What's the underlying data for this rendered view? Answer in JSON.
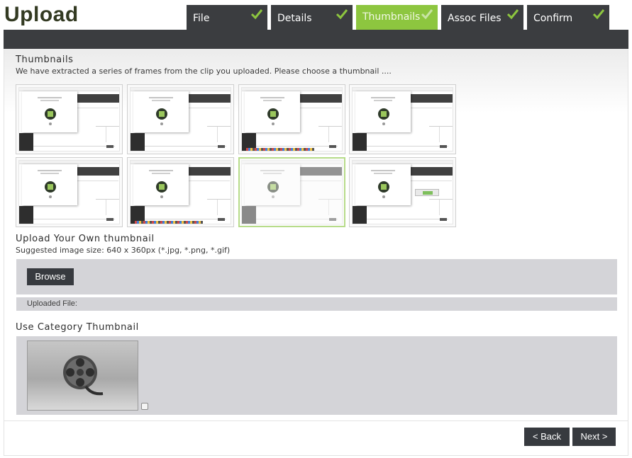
{
  "app": {
    "title": "Upload"
  },
  "steps": [
    {
      "label": "File",
      "completed": true,
      "active": false
    },
    {
      "label": "Details",
      "completed": true,
      "active": false
    },
    {
      "label": "Thumbnails",
      "completed": true,
      "active": true
    },
    {
      "label": "Assoc Files",
      "completed": true,
      "active": false
    },
    {
      "label": "Confirm",
      "completed": true,
      "active": false
    }
  ],
  "thumbnails_section": {
    "title": "Thumbnails",
    "description": "We have extracted a series of frames from the clip you uploaded. Please choose a thumbnail ....",
    "selected_index": 6,
    "frame_count": 8
  },
  "upload_section": {
    "title": "Upload Your Own thumbnail",
    "hint": "Suggested image size: 640 x 360px (*.jpg, *.png, *.gif)",
    "browse_label": "Browse",
    "uploaded_file_label": "Uploaded File:"
  },
  "category_section": {
    "title": "Use Category Thumbnail",
    "checked": false,
    "icon": "film-reel-icon"
  },
  "navigation": {
    "back_label": "< Back",
    "next_label": "Next >"
  },
  "colors": {
    "accent": "#8dc63f",
    "dark": "#3b3d40",
    "panel": "#d4d4d8"
  }
}
